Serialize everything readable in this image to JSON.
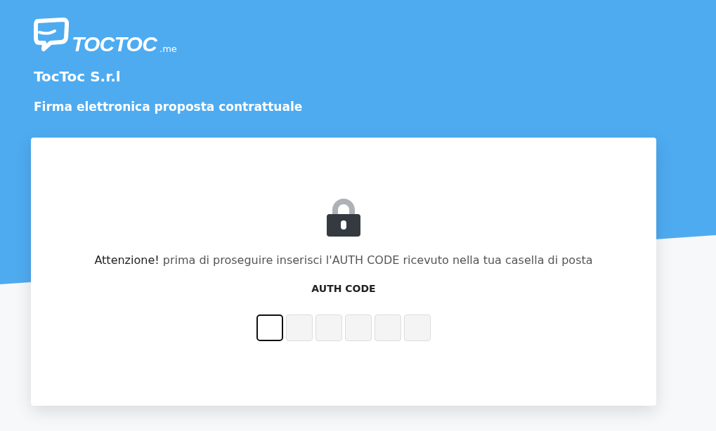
{
  "logo": {
    "name": "TOCTOC",
    "suffix": ".me"
  },
  "company": "TocToc S.r.l",
  "subtitle": "Firma elettronica proposta contrattuale",
  "notice": {
    "lead": "Attenzione!",
    "text": "prima di proseguire inserisci l'AUTH CODE ricevuto nella tua casella di posta"
  },
  "code_label": "AUTH CODE",
  "code_digits": [
    {
      "selected": true
    },
    {
      "selected": false
    },
    {
      "selected": false
    },
    {
      "selected": false
    },
    {
      "selected": false
    },
    {
      "selected": false
    }
  ]
}
